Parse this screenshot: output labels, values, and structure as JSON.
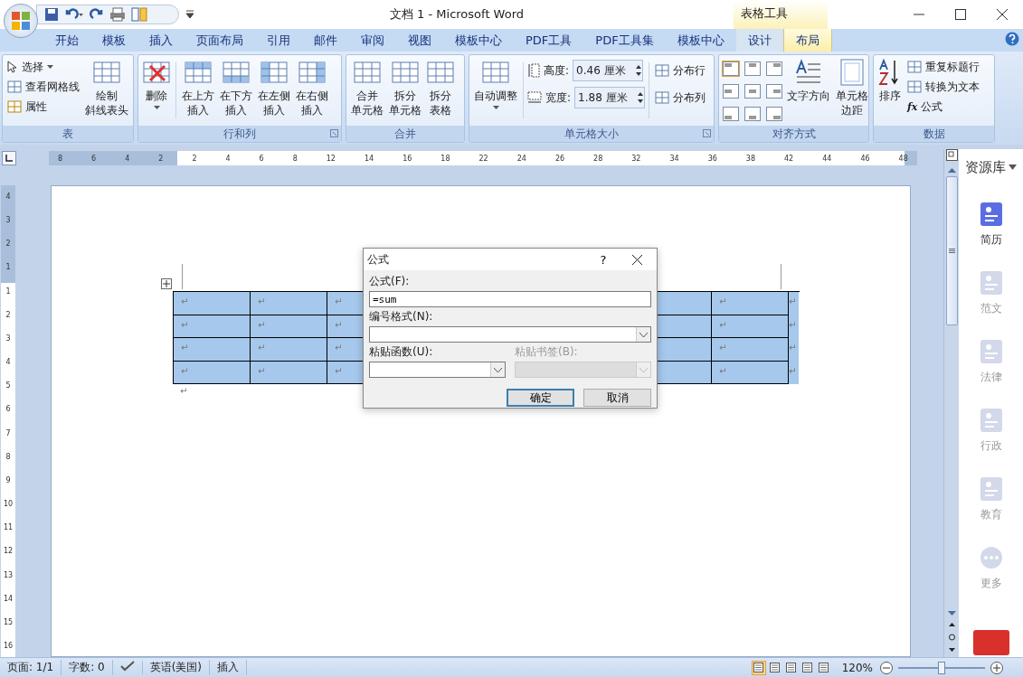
{
  "title_bar": {
    "title": "文档 1 - Microsoft Word",
    "context_label": "表格工具"
  },
  "tabs": [
    {
      "label": "开始",
      "selected": false,
      "contextual": false
    },
    {
      "label": "模板",
      "selected": false,
      "contextual": false
    },
    {
      "label": "插入",
      "selected": false,
      "contextual": false
    },
    {
      "label": "页面布局",
      "selected": false,
      "contextual": false
    },
    {
      "label": "引用",
      "selected": false,
      "contextual": false
    },
    {
      "label": "邮件",
      "selected": false,
      "contextual": false
    },
    {
      "label": "审阅",
      "selected": false,
      "contextual": false
    },
    {
      "label": "视图",
      "selected": false,
      "contextual": false
    },
    {
      "label": "模板中心",
      "selected": false,
      "contextual": false
    },
    {
      "label": "PDF工具",
      "selected": false,
      "contextual": false
    },
    {
      "label": "PDF工具集",
      "selected": false,
      "contextual": false
    },
    {
      "label": "模板中心",
      "selected": false,
      "contextual": false
    },
    {
      "label": "设计",
      "selected": false,
      "contextual": true
    },
    {
      "label": "布局",
      "selected": true,
      "contextual": true
    }
  ],
  "ribbon": {
    "table": {
      "title": "表",
      "select": "选择",
      "gridlines": "查看网格线",
      "properties": "属性",
      "diagonal": [
        "绘制",
        "斜线表头"
      ]
    },
    "rows_cols": {
      "title": "行和列",
      "delete": "删除",
      "inserts": [
        [
          "在上方",
          "插入"
        ],
        [
          "在下方",
          "插入"
        ],
        [
          "在左侧",
          "插入"
        ],
        [
          "在右侧",
          "插入"
        ]
      ]
    },
    "merge": {
      "title": "合并",
      "buttons": [
        [
          "合并",
          "单元格"
        ],
        [
          "拆分",
          "单元格"
        ],
        [
          "拆分",
          "表格"
        ]
      ]
    },
    "cell_size": {
      "title": "单元格大小",
      "autofit": "自动调整",
      "height_label": "高度:",
      "height": "0.46 厘米",
      "width_label": "宽度:",
      "width": "1.88 厘米",
      "distribute_rows": "分布行",
      "distribute_cols": "分布列"
    },
    "alignment": {
      "title": "对齐方式",
      "cells": [
        {
          "selected": true
        },
        {
          "selected": false
        },
        {
          "selected": false
        },
        {
          "selected": false
        },
        {
          "selected": false
        },
        {
          "selected": false
        },
        {
          "selected": false
        },
        {
          "selected": false
        },
        {
          "selected": false
        }
      ],
      "text_direction": "文字方向",
      "margins": [
        "单元格",
        "边距"
      ]
    },
    "data": {
      "title": "数据",
      "sort": "排序",
      "repeat_header": "重复标题行",
      "convert": "转换为文本",
      "formula_icon": "fx",
      "formula": "公式"
    }
  },
  "ruler": {
    "numbers": [
      "8",
      "6",
      "4",
      "2",
      "2",
      "4",
      "6",
      "8",
      "12",
      "14",
      "16",
      "18",
      "22",
      "24",
      "26",
      "28",
      "32",
      "34",
      "36",
      "38",
      "42",
      "44",
      "46",
      "48"
    ]
  },
  "vertical_ruler": {
    "numbers": [
      "4",
      "3",
      "2",
      "1",
      "1",
      "2",
      "3",
      "4",
      "5",
      "6",
      "7",
      "8",
      "9",
      "10",
      "11",
      "12",
      "13",
      "14",
      "15",
      "16"
    ]
  },
  "table": {
    "rows": [
      {
        "selected": true,
        "marks": [
          "↵",
          "↵",
          "↵",
          "↵"
        ],
        "end_mark": "↵"
      },
      {
        "selected": true,
        "marks": [
          "↵",
          "↵",
          "↵",
          "↵"
        ],
        "end_mark": "↵"
      },
      {
        "selected": true,
        "marks": [
          "↵",
          "↵",
          "↵",
          "↵"
        ],
        "end_mark": "↵"
      },
      {
        "selected": true,
        "marks": [
          "↵",
          "↵",
          "↵",
          "↵"
        ],
        "end_mark": "↵"
      }
    ],
    "after_mark": "↵"
  },
  "dialog": {
    "title": "公式",
    "help": "?",
    "formula_label": "公式(F):",
    "formula_value": "=sum",
    "number_format_label": "编号格式(N):",
    "paste_function_label": "粘贴函数(U):",
    "paste_bookmark_label": "粘贴书签(B):",
    "paste_bookmark_disabled": true,
    "ok": "确定",
    "cancel": "取消"
  },
  "side_panel": {
    "title": "资源库",
    "items": [
      {
        "label": "简历",
        "selected": true
      },
      {
        "label": "范文",
        "selected": false
      },
      {
        "label": "法律",
        "selected": false
      },
      {
        "label": "行政",
        "selected": false
      },
      {
        "label": "教育",
        "selected": false
      },
      {
        "label": "更多",
        "selected": false
      }
    ]
  },
  "status_bar": {
    "page": "页面: 1/1",
    "words": "字数: 0",
    "language": "英语(美国)",
    "mode": "插入",
    "views": [
      {
        "selected": true
      },
      {
        "selected": false
      },
      {
        "selected": false
      },
      {
        "selected": false
      },
      {
        "selected": false
      }
    ],
    "zoom": "120%",
    "level": 0.5
  }
}
